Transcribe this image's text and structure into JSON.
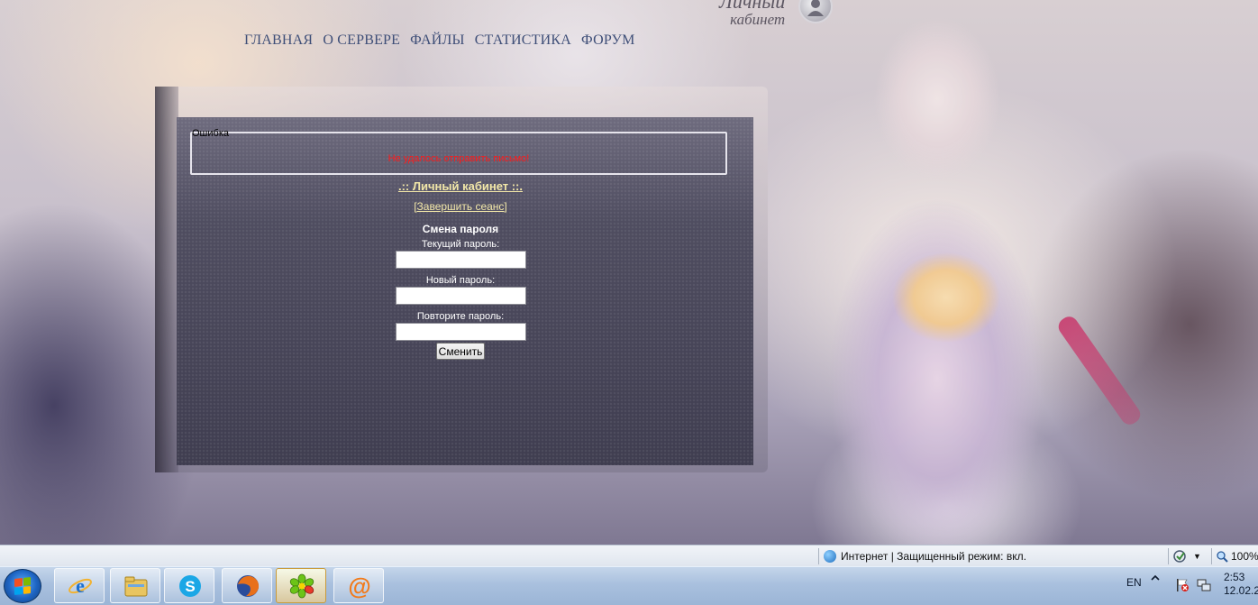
{
  "logo": {
    "line1": "Личный",
    "line2": "кабинет"
  },
  "nav": [
    "ГЛАВНАЯ",
    "О СЕРВЕРЕ",
    "ФАЙЛЫ",
    "СТАТИСТИКА",
    "ФОРУМ"
  ],
  "error": {
    "legend": "Ошибка",
    "message": "Не удалось отправить письмо!"
  },
  "cabinet": {
    "title": ".:: Личный кабинет ::.",
    "logout": "[Завершить сеанс]",
    "form": {
      "heading": "Смена пароля",
      "current_label": "Текущий пароль:",
      "new_label": "Новый пароль:",
      "repeat_label": "Повторите пароль:",
      "submit": "Сменить"
    }
  },
  "statusbar": {
    "zone": "Интернет | Защищенный режим: вкл.",
    "zoom": "100%"
  },
  "taskbar": {
    "apps": [
      "internet-explorer",
      "file-explorer",
      "skype",
      "firefox",
      "icq",
      "mail-agent"
    ],
    "tray": {
      "lang": "EN",
      "time": "2:53",
      "date": "12.02.2"
    }
  },
  "colors": {
    "nav": "#3f4f78",
    "link": "#f2e7a8",
    "error": "#ff1a1a"
  }
}
